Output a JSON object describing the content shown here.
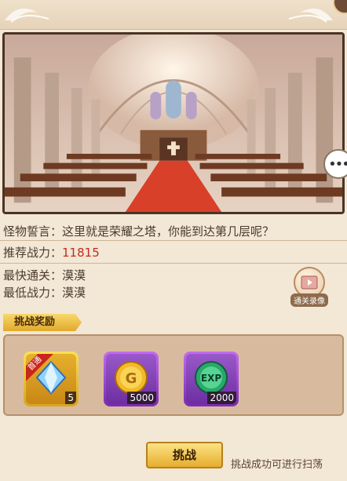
{
  "monster_quote": {
    "label": "怪物誓言：",
    "text": "这里就是荣耀之塔，你能到达第几层呢？"
  },
  "recommended_power": {
    "label": "推荐战力：",
    "value": "11815"
  },
  "fastest_clear": {
    "label": "最快通关：",
    "value": "漠漠"
  },
  "lowest_power": {
    "label": "最低战力：",
    "value": "漠漠"
  },
  "record_button": {
    "label": "通关录像"
  },
  "reward_section": {
    "title": "挑战奖励"
  },
  "rewards": [
    {
      "name": "crystal",
      "count": "5",
      "badge": "首通"
    },
    {
      "name": "gold-coin",
      "count": "5000",
      "icon_text": "G"
    },
    {
      "name": "exp-orb",
      "count": "2000",
      "icon_text": "EXP"
    }
  ],
  "challenge_button": {
    "label": "挑战"
  },
  "hint_text": "挑战成功可进行扫荡",
  "colors": {
    "background": "#f3e7d5",
    "highlight_red": "#c42a1e",
    "gold_frame": "#e6b02d",
    "purple_frame": "#7d2bb3"
  }
}
